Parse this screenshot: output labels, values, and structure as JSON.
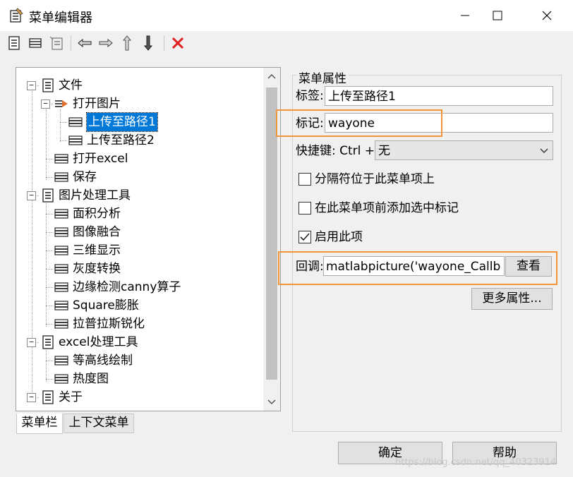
{
  "window": {
    "title": "菜单编辑器"
  },
  "tree": {
    "items": [
      {
        "label": "文件",
        "level": 0,
        "expanded": true
      },
      {
        "label": "打开图片",
        "level": 1,
        "expanded": true
      },
      {
        "label": "上传至路径1",
        "level": 2,
        "selected": true
      },
      {
        "label": "上传至路径2",
        "level": 2
      },
      {
        "label": "打开excel",
        "level": 1
      },
      {
        "label": "保存",
        "level": 1
      },
      {
        "label": "图片处理工具",
        "level": 0,
        "expanded": true
      },
      {
        "label": "面积分析",
        "level": 1
      },
      {
        "label": "图像融合",
        "level": 1
      },
      {
        "label": "三维显示",
        "level": 1
      },
      {
        "label": "灰度转换",
        "level": 1
      },
      {
        "label": "边缘检测canny算子",
        "level": 1
      },
      {
        "label": "Square膨胀",
        "level": 1
      },
      {
        "label": "拉普拉斯锐化",
        "level": 1
      },
      {
        "label": "excel处理工具",
        "level": 0,
        "expanded": true
      },
      {
        "label": "等高线绘制",
        "level": 1
      },
      {
        "label": "热度图",
        "level": 1
      },
      {
        "label": "关于",
        "level": 0,
        "expanded": true
      }
    ]
  },
  "tabs": {
    "menubar": "菜单栏",
    "context": "上下文菜单"
  },
  "props": {
    "group_title": "菜单属性",
    "label_label": "标签:",
    "label_value": "上传至路径1",
    "tag_label": "标记:",
    "tag_value": "wayone",
    "accel_label": "快捷键: Ctrl +",
    "accel_value": "无",
    "separator_label": "分隔符位于此菜单项上",
    "separator_checked": false,
    "check_label": "在此菜单项前添加选中标记",
    "check_checked": false,
    "enable_label": "启用此项",
    "enable_checked": true,
    "callback_label": "回调:",
    "callback_value": "matlabpicture('wayone_Callb",
    "view_button": "查看",
    "more_button": "更多属性..."
  },
  "buttons": {
    "ok": "确定",
    "help": "帮助"
  },
  "watermark": "https://blog.csdn.net/qq_40323914",
  "colors": {
    "selection": "#0078d7",
    "highlight": "#f0963a",
    "delete": "#e02020"
  }
}
